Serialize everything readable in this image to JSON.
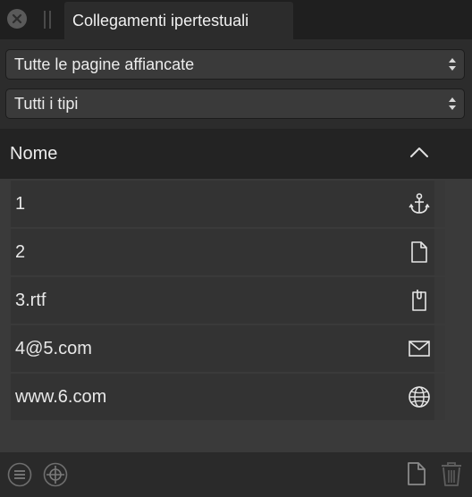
{
  "panel": {
    "tab_title": "Collegamenti ipertestuali"
  },
  "filters": {
    "pages_select": "Tutte le pagine affiancate",
    "types_select": "Tutti i tipi"
  },
  "list": {
    "header_label": "Nome",
    "sort_order": "ascending",
    "rows": [
      {
        "label": "1",
        "icon": "anchor-icon"
      },
      {
        "label": "2",
        "icon": "page-icon"
      },
      {
        "label": "3.rtf",
        "icon": "file-clip-icon"
      },
      {
        "label": "4@5.com",
        "icon": "envelope-icon"
      },
      {
        "label": "www.6.com",
        "icon": "globe-icon"
      }
    ]
  },
  "footer": {
    "icons": [
      "menu-icon",
      "crosshair-icon",
      "new-document-icon",
      "trash-icon"
    ]
  }
}
